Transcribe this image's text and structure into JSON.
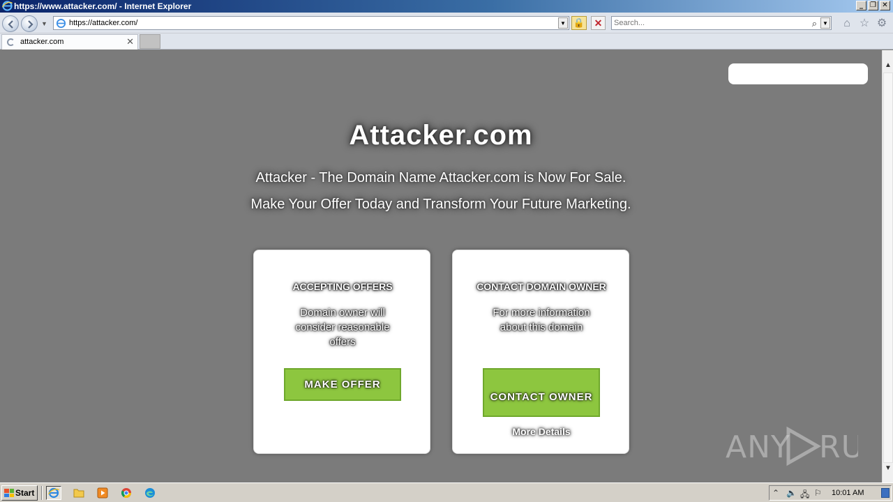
{
  "window": {
    "title": "https://www.attacker.com/ - Internet Explorer",
    "controls": {
      "minimize": "_",
      "restore": "❐",
      "close": "✕"
    }
  },
  "navbar": {
    "url": "https://attacker.com/",
    "search_placeholder": "Search...",
    "icons": [
      "back-icon",
      "forward-icon",
      "lock-icon",
      "stop-icon",
      "search-icon",
      "home-icon",
      "favorites-icon",
      "tools-gear-icon"
    ]
  },
  "tabs": [
    {
      "label": "attacker.com",
      "loading": true
    }
  ],
  "page": {
    "headline": "Attacker.com",
    "subline1": "Attacker - The Domain Name Attacker.com is Now For Sale.",
    "subline2": "Make Your Offer Today and Transform Your Future Marketing.",
    "cards": [
      {
        "title": "ACCEPTING OFFERS",
        "description": "Domain owner will consider reasonable offers",
        "button": "MAKE OFFER"
      },
      {
        "title": "CONTACT DOMAIN OWNER",
        "description": "For more information about this domain",
        "button": "CONTACT OWNER",
        "link": "More Details"
      }
    ],
    "watermark": "ANY RUN"
  },
  "taskbar": {
    "start_label": "Start",
    "quick_launch": [
      "internet-explorer-icon",
      "folder-icon",
      "media-player-icon",
      "chrome-icon",
      "edge-icon"
    ],
    "clock": "10:01 AM"
  },
  "colors": {
    "page_background": "#7b7b7b",
    "button_green": "#8dc63f",
    "card_background": "#ffffff"
  }
}
